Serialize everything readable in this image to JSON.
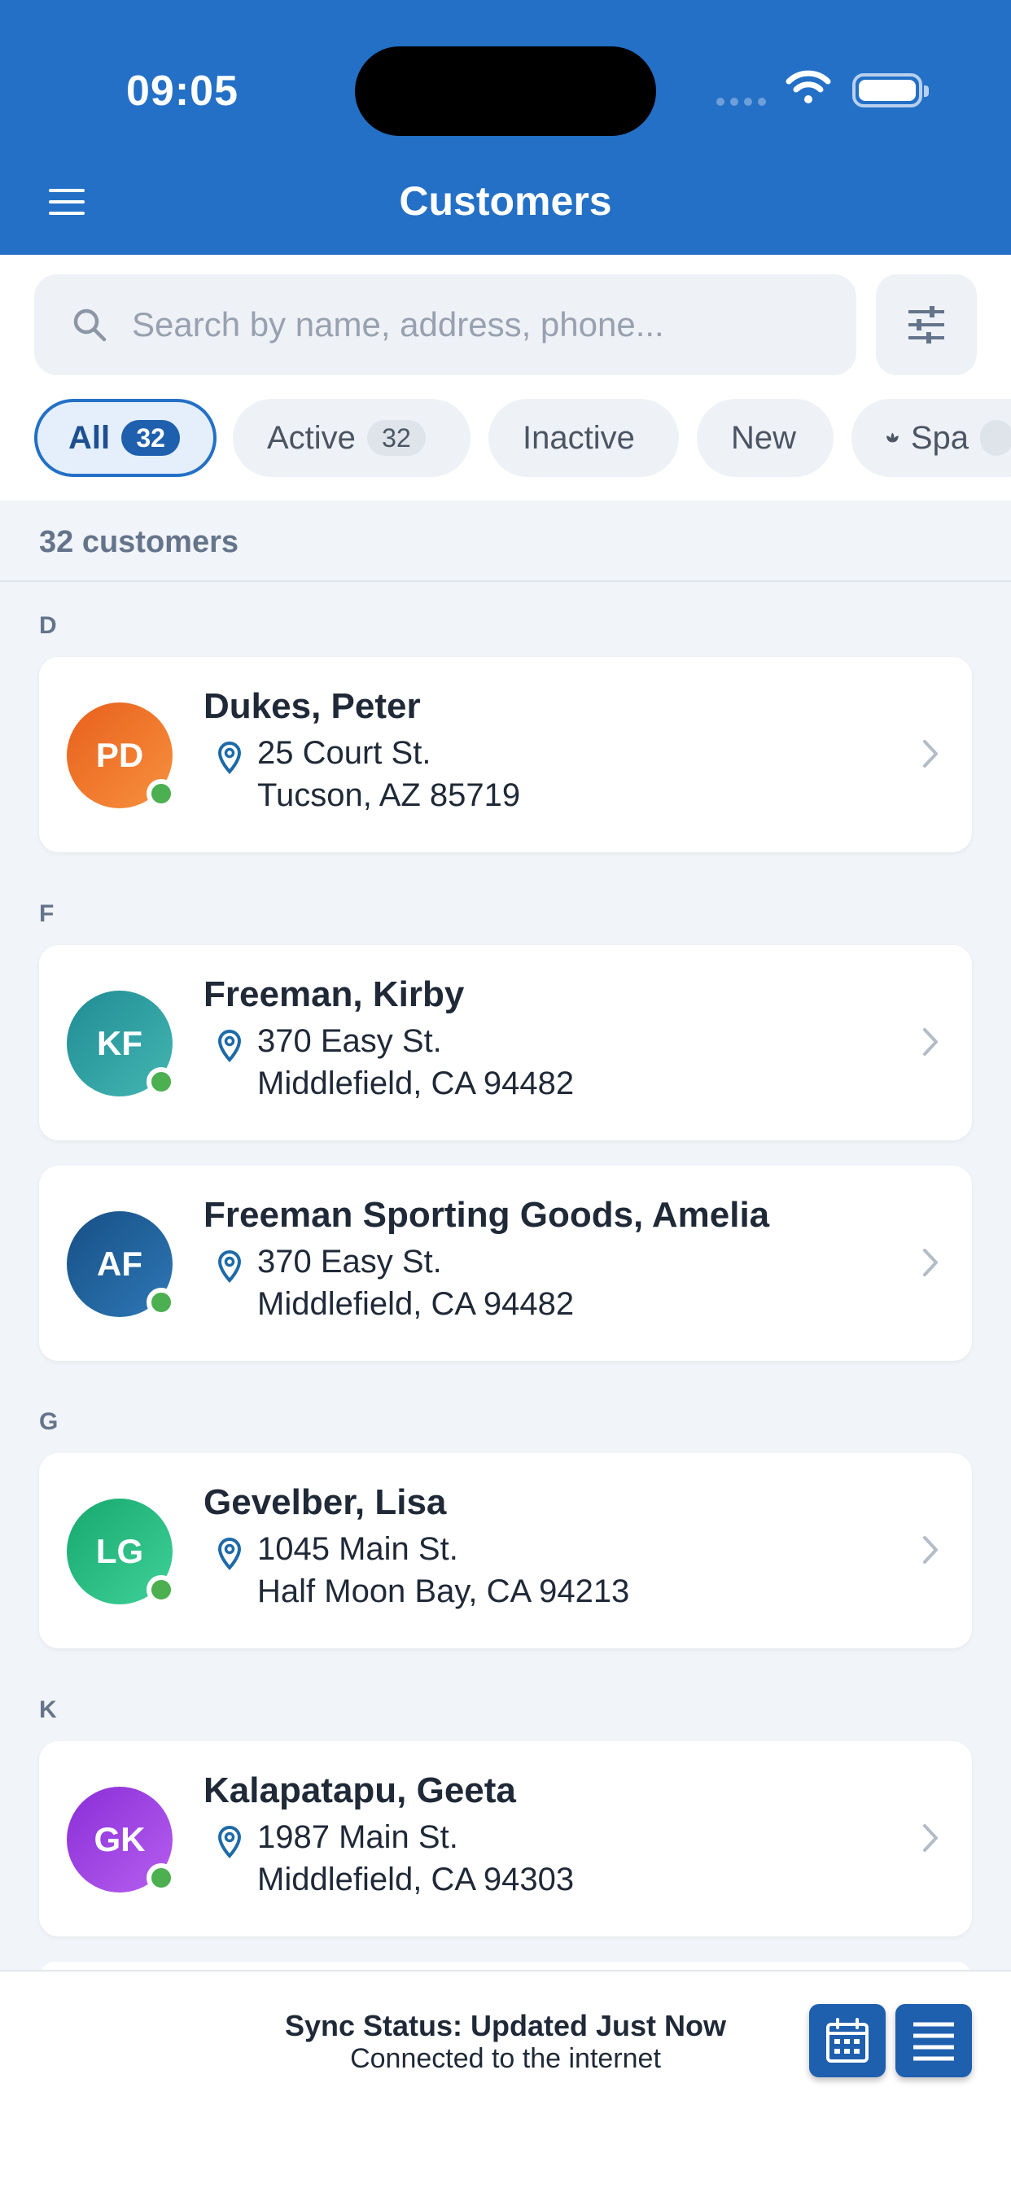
{
  "status_bar": {
    "time": "09:05"
  },
  "header": {
    "title": "Customers"
  },
  "search": {
    "placeholder": "Search by name, address, phone..."
  },
  "filters": [
    {
      "label": "All",
      "count": "32",
      "active": true
    },
    {
      "label": "Active",
      "count": "32",
      "active": false
    },
    {
      "label": "Inactive",
      "active": false
    },
    {
      "label": "New",
      "active": false
    },
    {
      "label": "Spa",
      "icon": "spa-icon",
      "active": false
    }
  ],
  "summary": {
    "count_text": "32 customers"
  },
  "sections": [
    {
      "letter": "D",
      "customers": [
        {
          "initials": "PD",
          "name": "Dukes, Peter",
          "address_line1": "25 Court St.",
          "address_line2": "Tucson, AZ 85719",
          "avatar_color": "#f07a2a",
          "online": true
        }
      ]
    },
    {
      "letter": "F",
      "customers": [
        {
          "initials": "KF",
          "name": "Freeman, Kirby",
          "address_line1": "370 Easy St.",
          "address_line2": "Middlefield, CA 94482",
          "avatar_color": "#2a9aa0",
          "online": true
        },
        {
          "initials": "AF",
          "name": "Freeman Sporting Goods, Amelia",
          "address_line1": "370 Easy St.",
          "address_line2": "Middlefield, CA 94482",
          "avatar_color": "#1f5e99",
          "online": true
        }
      ]
    },
    {
      "letter": "G",
      "customers": [
        {
          "initials": "LG",
          "name": "Gevelber, Lisa",
          "address_line1": "1045 Main St.",
          "address_line2": "Half Moon Bay, CA 94213",
          "avatar_color": "#1fba7c",
          "online": true
        }
      ]
    },
    {
      "letter": "K",
      "customers": [
        {
          "initials": "GK",
          "name": "Kalapatapu, Geeta",
          "address_line1": "1987 Main St.",
          "address_line2": "Middlefield, CA 94303",
          "avatar_color": "#9b3fe0",
          "online": true
        }
      ]
    }
  ],
  "footer": {
    "sync_title": "Sync Status: Updated Just Now",
    "sync_subtitle": "Connected to the internet",
    "calendar_button_icon": "calendar-icon",
    "list_button_icon": "list-icon"
  },
  "colors": {
    "header_blue": "#2370c6",
    "accent_dark_blue": "#1e5fae",
    "online_green": "#4caf50"
  }
}
